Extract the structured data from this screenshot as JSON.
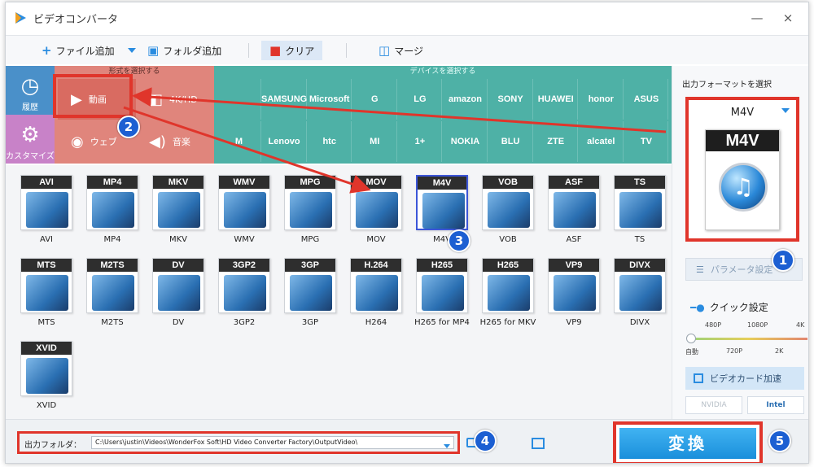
{
  "window": {
    "title": "ビデオコンバータ",
    "minimize_glyph": "—",
    "close_glyph": "×"
  },
  "toolbar": {
    "add_file": "ファイル追加",
    "add_folder": "フォルダ追加",
    "clear": "クリア",
    "merge": "マージ"
  },
  "categories": {
    "format_header": "形式を選択する",
    "device_header": "デバイスを選択する",
    "history": "履歴",
    "customize": "カスタマイズ",
    "video": "動画",
    "fourk": "4K/HD",
    "web": "ウェブ",
    "audio": "音楽",
    "brands_row1": [
      "",
      "SAMSUNG",
      "Microsoft",
      "G",
      "LG",
      "amazon",
      "SONY",
      "HUAWEI",
      "honor",
      "ASUS"
    ],
    "brands_row2": [
      "M",
      "Lenovo",
      "htc",
      "MI",
      "1+",
      "NOKIA",
      "BLU",
      "ZTE",
      "alcatel",
      "TV"
    ]
  },
  "formats_row1": [
    "AVI",
    "MP4",
    "MKV",
    "WMV",
    "MPG",
    "MOV",
    "M4V",
    "VOB",
    "ASF",
    "TS"
  ],
  "formats_row2": [
    {
      "tag": "MTS",
      "label": "MTS"
    },
    {
      "tag": "M2TS",
      "label": "M2TS"
    },
    {
      "tag": "DV",
      "label": "DV"
    },
    {
      "tag": "3GP2",
      "label": "3GP2"
    },
    {
      "tag": "3GP",
      "label": "3GP"
    },
    {
      "tag": "H.264",
      "label": "H264"
    },
    {
      "tag": "H265",
      "label": "H265 for MP4"
    },
    {
      "tag": "H265",
      "label": "H265 for MKV"
    },
    {
      "tag": "VP9",
      "label": "VP9"
    },
    {
      "tag": "DIVX",
      "label": "DIVX"
    }
  ],
  "formats_row3": [
    {
      "tag": "XVID",
      "label": "XVID"
    }
  ],
  "right_panel": {
    "title": "出力フォーマットを選択",
    "selected_format": "M4V",
    "icon_tag": "M4V",
    "param_button": "パラメータ設定",
    "quick_setting": "クイック設定",
    "quality_top": [
      "480P",
      "1080P",
      "4K"
    ],
    "quality_bottom": [
      "自動",
      "720P",
      "2K"
    ],
    "gpu_button": "ビデオカード加速",
    "vendor1": "NVIDIA",
    "vendor2": "Intel"
  },
  "bottom": {
    "folder_label": "出力フォルダ：",
    "folder_path": "C:\\Users\\justin\\Videos\\WonderFox Soft\\HD Video Converter Factory\\OutputVideo\\",
    "convert": "変換"
  },
  "badges": [
    "1",
    "2",
    "3",
    "4",
    "5"
  ],
  "colors": {
    "annotation_red": "#e0352b",
    "badge_blue": "#1c5fd2",
    "format_area": "#e0857c",
    "device_area": "#4eb1a6",
    "convert_blue": "#1a8fdb"
  }
}
